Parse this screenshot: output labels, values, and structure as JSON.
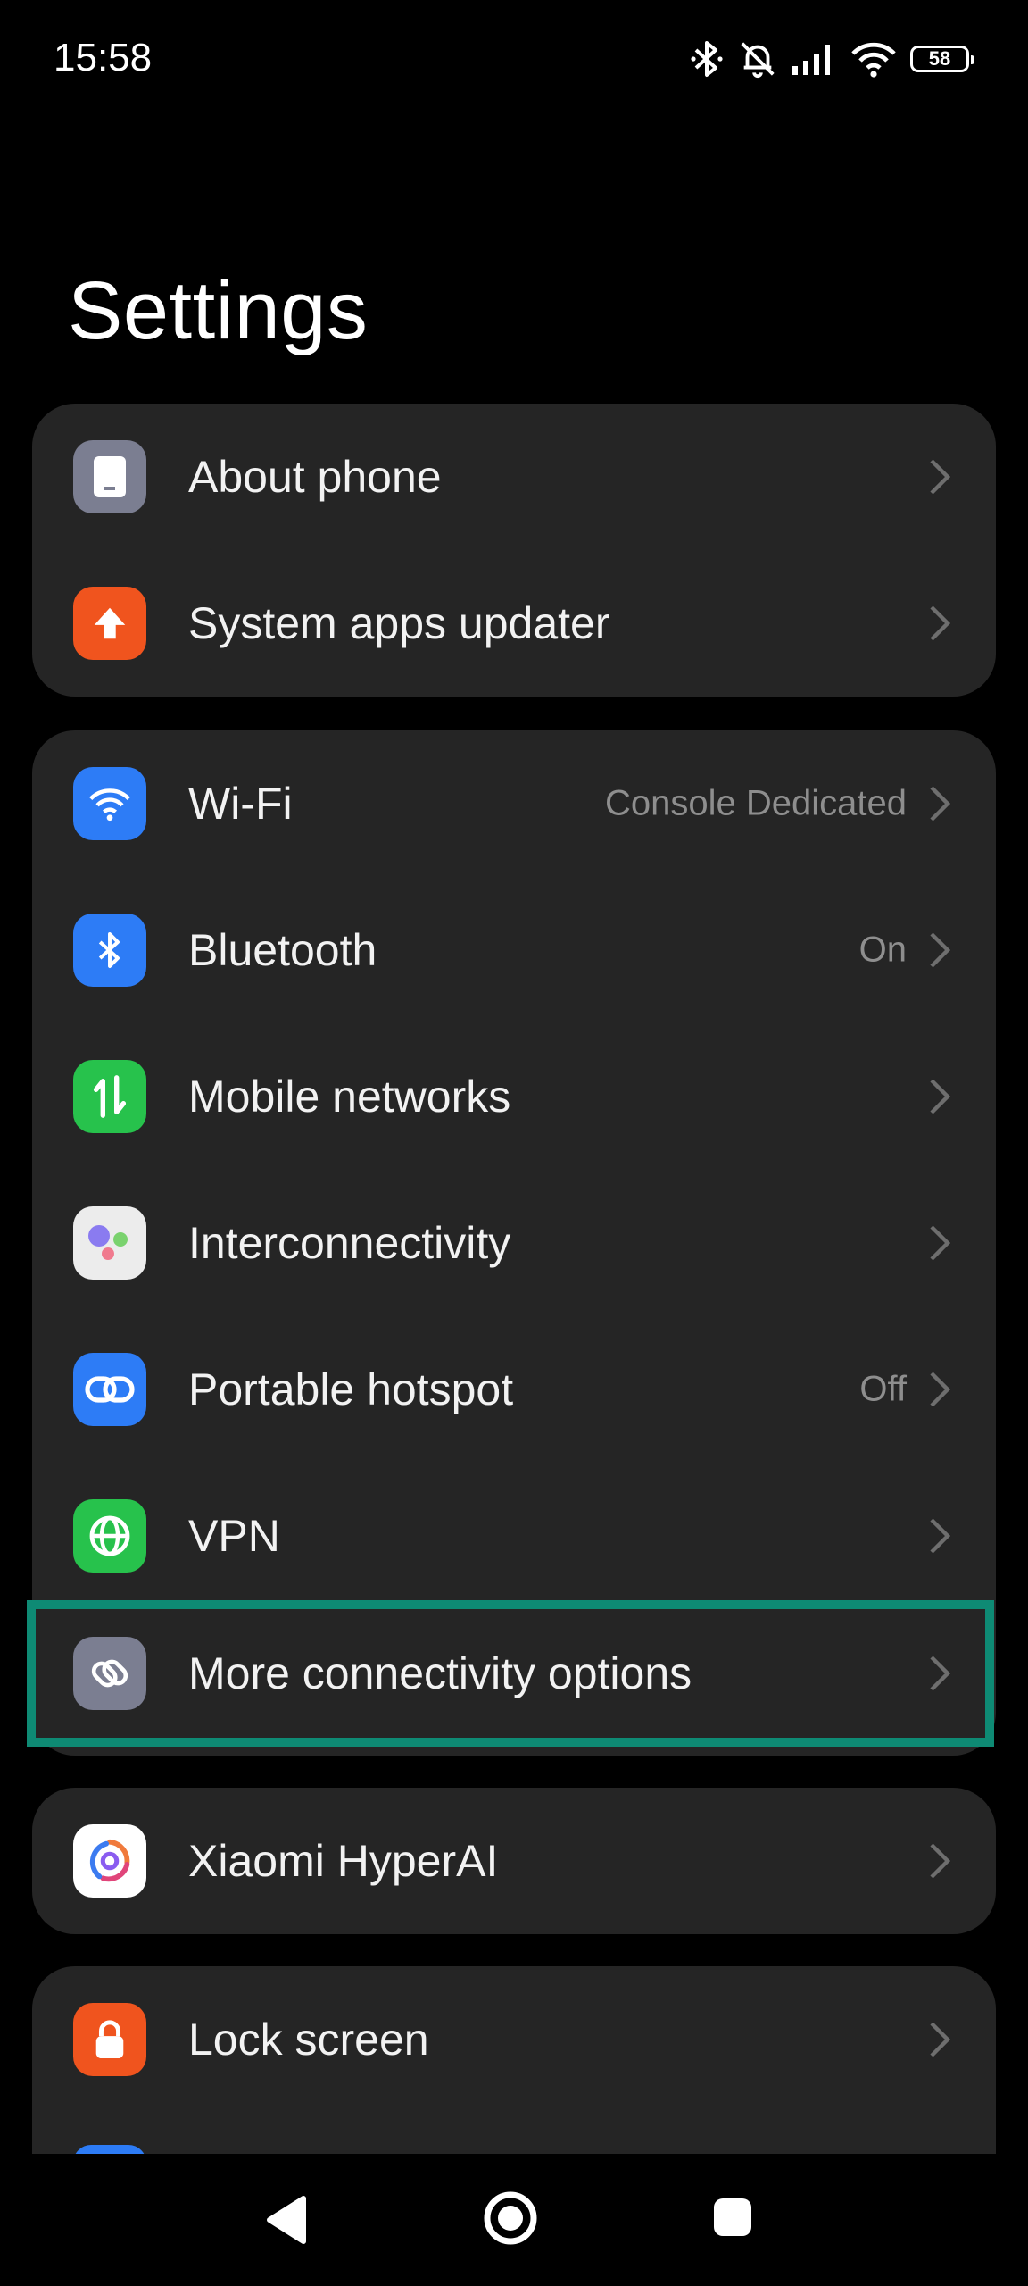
{
  "status_bar": {
    "time": "15:58",
    "battery": "58",
    "icons": [
      "bluetooth-icon",
      "muted-bell-icon",
      "signal-icon",
      "wifi-icon",
      "battery-icon"
    ]
  },
  "page": {
    "title": "Settings"
  },
  "groups": [
    {
      "items": [
        {
          "label": "About phone",
          "value": "",
          "icon": "phone-icon",
          "icon_bg": "#7b7e91"
        },
        {
          "label": "System apps updater",
          "value": "",
          "icon": "upload-arrow-icon",
          "icon_bg": "#f0541e"
        }
      ]
    },
    {
      "items": [
        {
          "label": "Wi-Fi",
          "value": "Console Dedicated",
          "icon": "wifi-icon",
          "icon_bg": "#2d7cf6"
        },
        {
          "label": "Bluetooth",
          "value": "On",
          "icon": "bluetooth-icon",
          "icon_bg": "#2d7cf6"
        },
        {
          "label": "Mobile networks",
          "value": "",
          "icon": "mobile-data-icon",
          "icon_bg": "#27c24c"
        },
        {
          "label": "Interconnectivity",
          "value": "",
          "icon": "interconnect-dots-icon",
          "icon_bg": "#ececec"
        },
        {
          "label": "Portable hotspot",
          "value": "Off",
          "icon": "link-icon",
          "icon_bg": "#2d7cf6"
        },
        {
          "label": "VPN",
          "value": "",
          "icon": "globe-icon",
          "icon_bg": "#27c24c"
        },
        {
          "label": "More connectivity options",
          "value": "",
          "icon": "connectivity-link-icon",
          "icon_bg": "#7b7e91"
        }
      ]
    },
    {
      "items": [
        {
          "label": "Xiaomi HyperAI",
          "value": "",
          "icon": "hyperai-swirl-icon",
          "icon_bg": "#ffffff"
        }
      ]
    },
    {
      "items": [
        {
          "label": "Lock screen",
          "value": "",
          "icon": "lock-icon",
          "icon_bg": "#f0541e"
        }
      ]
    }
  ],
  "highlight_color": "#0e8a74",
  "nav_bar": {
    "buttons": [
      "back-icon",
      "home-icon",
      "recents-icon"
    ]
  }
}
